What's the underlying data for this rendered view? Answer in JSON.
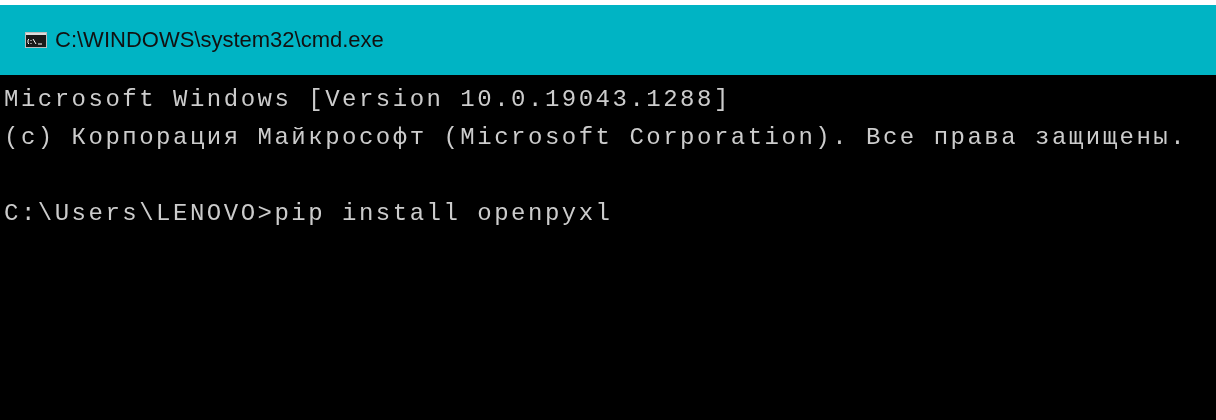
{
  "window": {
    "title": "C:\\WINDOWS\\system32\\cmd.exe"
  },
  "console": {
    "blocks": [
      [
        "Microsoft Windows [Version 10.0.19043.1288]",
        "(c) Корпорация Майкрософт (Microsoft Corporation). Все права защищены."
      ],
      [
        "C:\\Users\\LENOVO>pip install openpyxl"
      ]
    ]
  }
}
